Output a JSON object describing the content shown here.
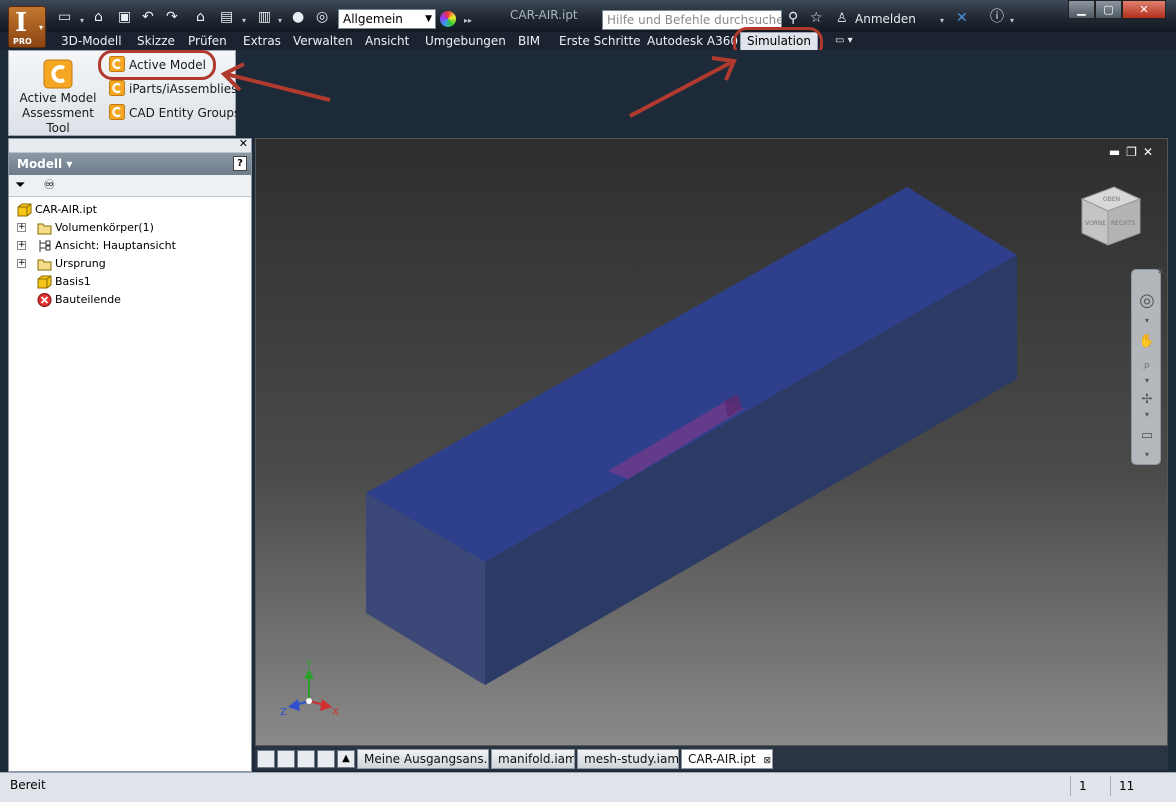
{
  "titlebar": {
    "document_title": "CAR-AIR.ipt",
    "workspace": "Allgemein",
    "help_search_placeholder": "Hilfe und Befehle durchsuchen...",
    "sign_in": "Anmelden",
    "app_badge": "PRO",
    "app_letter": "I"
  },
  "ribbon_tabs": [
    "3D-Modell",
    "Skizze",
    "Prüfen",
    "Extras",
    "Verwalten",
    "Ansicht",
    "Umgebungen",
    "BIM",
    "Erste Schritte",
    "Autodesk A360",
    "Simulation"
  ],
  "ribbon": {
    "assessment_tool_line1": "Active Model",
    "assessment_tool_line2": "Assessment Tool",
    "items": [
      "Active Model",
      "iParts/iAssemblies",
      "CAD Entity Groups"
    ]
  },
  "browser": {
    "title": "Modell ▾",
    "nodes": [
      "CAR-AIR.ipt",
      "Volumenkörper(1)",
      "Ansicht: Hauptansicht",
      "Ursprung",
      "Basis1",
      "Bauteilende"
    ]
  },
  "viewcube": {
    "top": "OBEN",
    "front": "VORNE",
    "right": "RECHTS"
  },
  "axes": {
    "x": "X",
    "y": "Y",
    "z": "Z"
  },
  "document_tabs": [
    "Meine Ausgangsans...",
    "manifold.iam",
    "mesh-study.iam",
    "CAR-AIR.ipt"
  ],
  "statusbar": {
    "text": "Bereit",
    "field1": "1",
    "field2": "11"
  },
  "colors": {
    "accent_annotation": "#b03a2e",
    "block_top": "#2e3f8c",
    "block_front": "#3a4777",
    "block_side": "#2c3a66"
  }
}
